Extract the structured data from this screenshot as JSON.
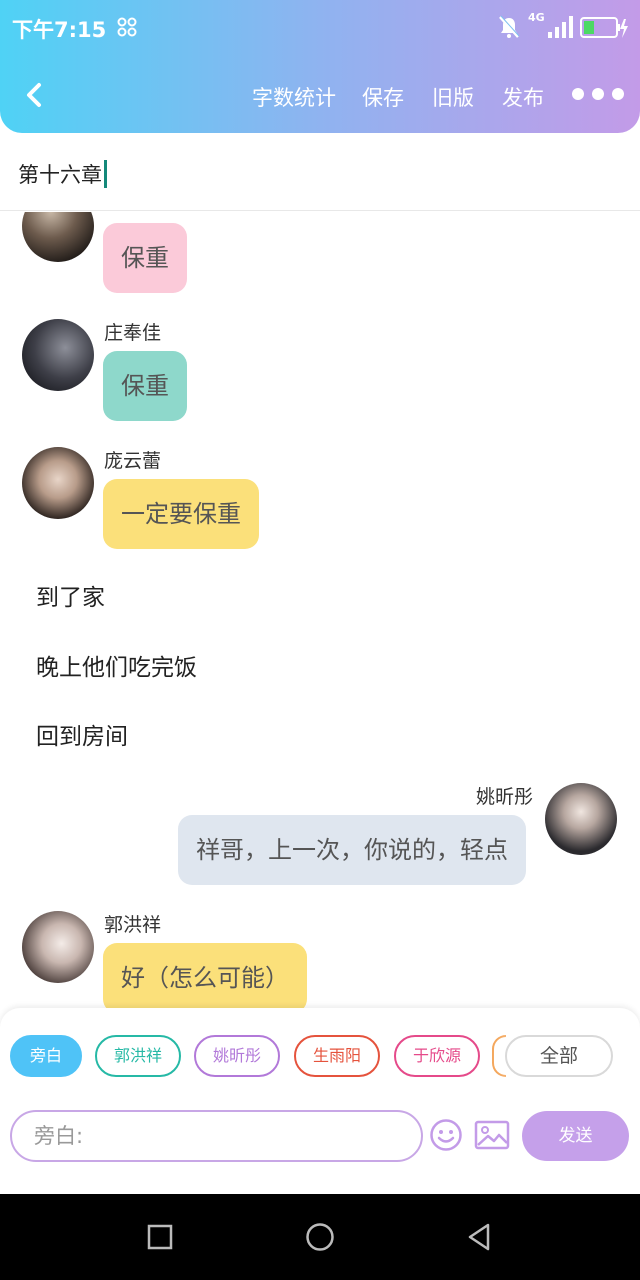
{
  "status_bar": {
    "time": "下午7:15",
    "network": "4G",
    "icons": [
      "scan-icon",
      "mute-bell-icon",
      "signal-icon",
      "battery-charging-icon"
    ]
  },
  "toolbar": {
    "word_count": "字数统计",
    "save": "保存",
    "old_version": "旧版",
    "publish": "发布",
    "icons": [
      "back-icon",
      "more-icon"
    ]
  },
  "chapter": {
    "title": "第十六章"
  },
  "messages": [
    {
      "type": "left",
      "name": "",
      "text": "保重",
      "color": "#fbcad9"
    },
    {
      "type": "left",
      "name": "庄奉佳",
      "text": "保重",
      "color": "#8ed8cb"
    },
    {
      "type": "left",
      "name": "庞云蕾",
      "text": "一定要保重",
      "color": "#fbe07a"
    },
    {
      "type": "narration",
      "text": "到了家"
    },
    {
      "type": "narration",
      "text": "晚上他们吃完饭"
    },
    {
      "type": "narration",
      "text": "回到房间"
    },
    {
      "type": "right",
      "name": "姚昕彤",
      "text": "祥哥，上一次，你说的，轻点",
      "color": "#dfe6ef"
    },
    {
      "type": "left",
      "name": "郭洪祥",
      "text": "好（怎么可能）",
      "color": "#fbe07a"
    }
  ],
  "role_chips": [
    {
      "label": "旁白",
      "color": "#4fc3f7",
      "selected": true
    },
    {
      "label": "郭洪祥",
      "color": "#26b9a6",
      "selected": false
    },
    {
      "label": "姚昕彤",
      "color": "#b279d9",
      "selected": false
    },
    {
      "label": "生雨阳",
      "color": "#e5533d",
      "selected": false
    },
    {
      "label": "于欣源",
      "color": "#e54a8a",
      "selected": false
    }
  ],
  "all_button": "全部",
  "input": {
    "placeholder": "旁白:"
  },
  "send_button": "发送",
  "nav_icons": [
    "recent-apps-icon",
    "home-icon",
    "back-triangle-icon"
  ]
}
